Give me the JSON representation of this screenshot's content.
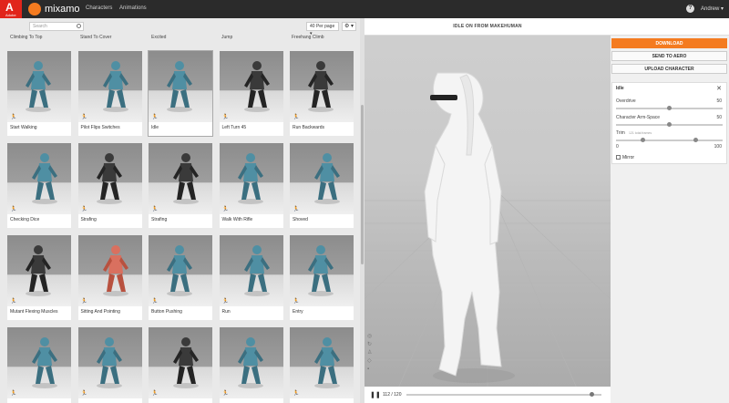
{
  "app": {
    "adobe_mark": "A",
    "adobe_label": "Adobe",
    "brand": "mixamo",
    "nav": [
      "Characters",
      "Animations"
    ],
    "help": "?",
    "user": "Andrew ▾"
  },
  "browser": {
    "search_placeholder": "Search",
    "per_page": "40 Per page ▾",
    "gear": "⚙ ▾",
    "partial_row": [
      "Climbing To Top",
      "Stand To Cover",
      "Excited",
      "Jump",
      "Freehang Climb"
    ],
    "cards": [
      {
        "label": "Start Walking",
        "figure": "teal"
      },
      {
        "label": "Pilot Flips Switches",
        "figure": "teal"
      },
      {
        "label": "Idle",
        "figure": "teal",
        "selected": true
      },
      {
        "label": "Left Turn 45",
        "figure": "dark"
      },
      {
        "label": "Run Backwards",
        "figure": "dark"
      },
      {
        "label": "Checking Dice",
        "figure": "teal"
      },
      {
        "label": "Strafing",
        "figure": "dark"
      },
      {
        "label": "Strafing",
        "figure": "dark"
      },
      {
        "label": "Walk With Rifle",
        "figure": "teal"
      },
      {
        "label": "Shoved",
        "figure": "teal"
      },
      {
        "label": "Mutant Flexing Muscles",
        "figure": "dark"
      },
      {
        "label": "Sitting And Pointing",
        "figure": "red"
      },
      {
        "label": "Button Pushing",
        "figure": "teal"
      },
      {
        "label": "Run",
        "figure": "teal"
      },
      {
        "label": "Entry",
        "figure": "teal"
      },
      {
        "label": "",
        "figure": "teal"
      },
      {
        "label": "",
        "figure": "teal"
      },
      {
        "label": "",
        "figure": "dark"
      },
      {
        "label": "",
        "figure": "teal"
      },
      {
        "label": "",
        "figure": "teal"
      }
    ]
  },
  "viewer": {
    "title": "IDLE ON FROM MAKEHUMAN",
    "pause_icon": "❚❚",
    "frames": "112 / 120",
    "progress": 0.93
  },
  "actions": {
    "download": "DOWNLOAD",
    "send": "SEND TO AERO",
    "upload": "UPLOAD CHARACTER"
  },
  "settings": {
    "title": "Idle",
    "close": "✕",
    "overdrive_label": "Overdrive",
    "overdrive_value": "50",
    "overdrive_level": 0.5,
    "armspace_label": "Character Arm-Space",
    "armspace_value": "50",
    "armspace_level": 0.5,
    "trim_label": "Trim",
    "trim_sub": "121 total frames",
    "trim_min": "0",
    "trim_max": "100",
    "trim_start": 0.25,
    "trim_end": 0.75,
    "mirror_label": "Mirror"
  }
}
